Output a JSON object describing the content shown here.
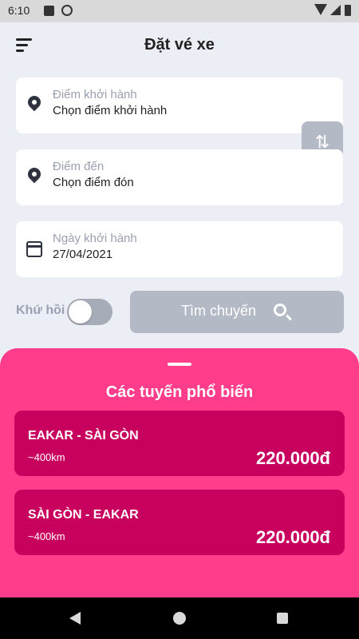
{
  "status_bar": {
    "time": "6:10"
  },
  "header": {
    "title": "Đặt vé xe",
    "menu_icon": "menu-icon"
  },
  "departure": {
    "label": "Điểm khởi hành",
    "value": "Chọn điểm khởi hành",
    "icon": "location-pin-icon"
  },
  "destination": {
    "label": "Điểm đến",
    "value": "Chọn điểm đón",
    "icon": "location-pin-icon"
  },
  "swap": {
    "icon": "swap-icon",
    "glyph": "⇅"
  },
  "date": {
    "label": "Ngày khởi hành",
    "value": "27/04/2021",
    "icon": "calendar-icon"
  },
  "round_trip": {
    "label": "Khứ hồi",
    "enabled": false
  },
  "search": {
    "label": "Tìm chuyến",
    "icon": "search-icon"
  },
  "popular": {
    "title": "Các tuyến phổ biến",
    "routes": [
      {
        "name": "EAKAR - SÀI GÒN",
        "distance": "~400km",
        "price": "220.000đ"
      },
      {
        "name": "SÀI GÒN - EAKAR",
        "distance": "~400km",
        "price": "220.000đ"
      }
    ]
  },
  "colors": {
    "background": "#eceef6",
    "sheet": "#ff3d8b",
    "route_card": "#c8005e",
    "disabled_button": "#b4b9c6"
  }
}
